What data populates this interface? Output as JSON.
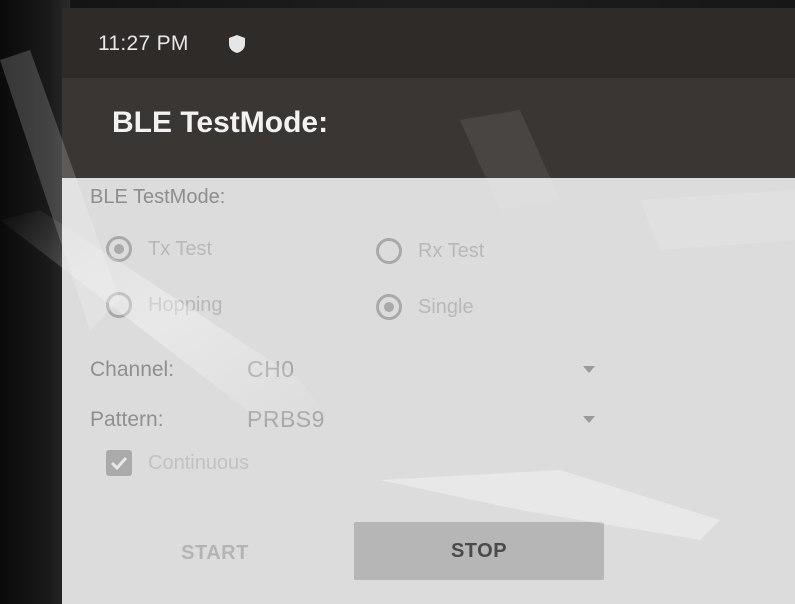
{
  "status_bar": {
    "time": "11:27 PM",
    "icon": "shield-icon"
  },
  "app_bar": {
    "title": "BLE TestMode:"
  },
  "form": {
    "section_label": "BLE TestMode:",
    "test_type": {
      "options": [
        {
          "label": "Tx Test",
          "checked": true
        },
        {
          "label": "Rx Test",
          "checked": false
        }
      ]
    },
    "hop_mode": {
      "options": [
        {
          "label": "Hopping",
          "checked": false
        },
        {
          "label": "Single",
          "checked": true
        }
      ]
    },
    "channel": {
      "label": "Channel:",
      "value": "CH0"
    },
    "pattern": {
      "label": "Pattern:",
      "value": "PRBS9"
    },
    "continuous": {
      "label": "Continuous",
      "checked": true
    }
  },
  "actions": {
    "start_label": "START",
    "stop_label": "STOP"
  },
  "colors": {
    "status_bar_bg": "#2e2b29",
    "app_bar_bg": "#3a3633",
    "content_bg": "#dcdcdc",
    "stop_button_bg": "#b6b6b6"
  }
}
